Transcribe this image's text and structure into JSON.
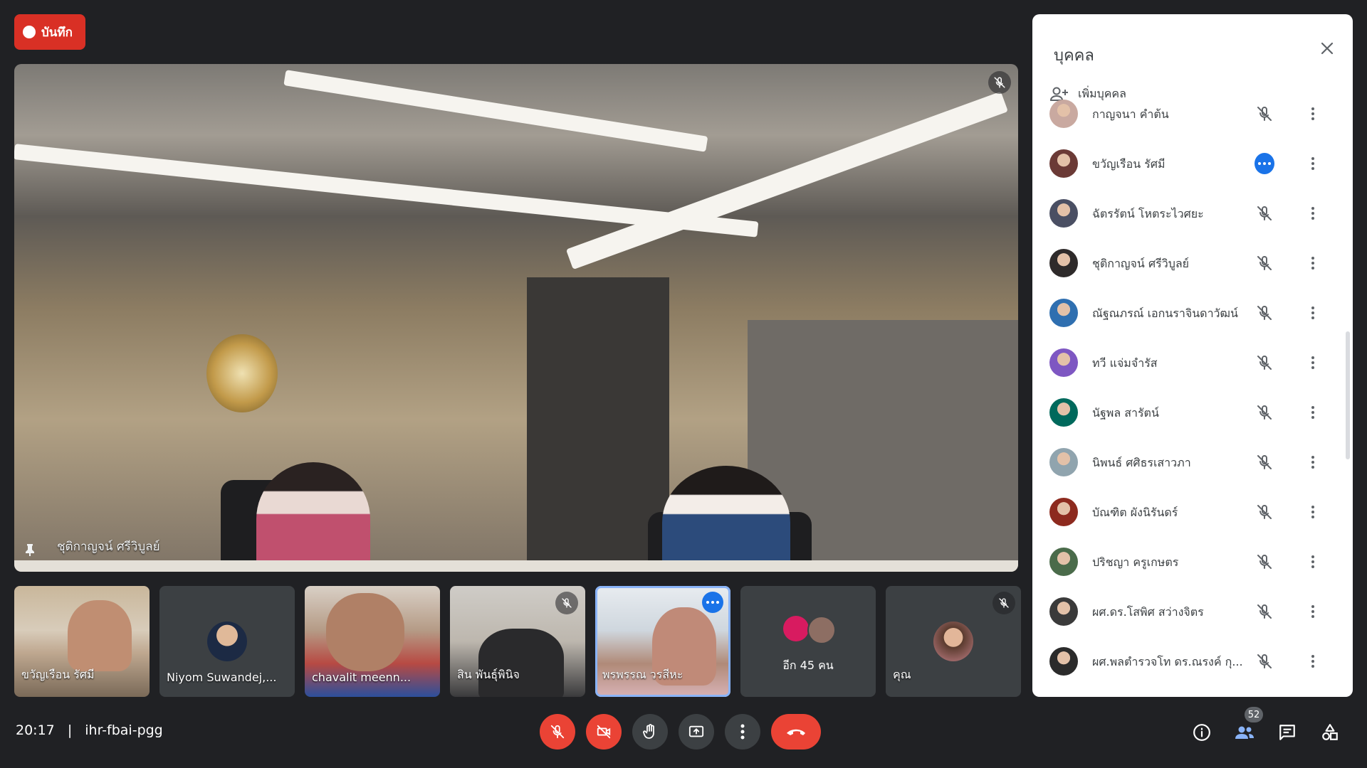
{
  "record": {
    "label": "บันทึก"
  },
  "main_video": {
    "name": "ชุติกาญจน์ ศรีวิบูลย์"
  },
  "thumbnails": [
    {
      "name": "ขวัญเรือน รัศมี"
    },
    {
      "name": "Niyom Suwandej,..."
    },
    {
      "name": "chavalit meenn..."
    },
    {
      "name": "สิน พันธุ์พินิจ"
    },
    {
      "name": "พรพรรณ วรสีหะ"
    },
    {
      "name": "อีก 45 คน"
    },
    {
      "name": "คุณ"
    }
  ],
  "meeting": {
    "time": "20:17",
    "separator": "|",
    "code": "ihr-fbai-pgg"
  },
  "controls": {
    "participants_count": "52",
    "icons": [
      "mic-off-icon",
      "camera-off-icon",
      "raise-hand-icon",
      "present-icon",
      "more-options-icon",
      "hang-up-icon",
      "info-icon",
      "people-icon",
      "chat-icon",
      "activities-icon"
    ]
  },
  "panel": {
    "title": "บุคคล",
    "add_people": "เพิ่มบุคคล",
    "people": [
      {
        "name": "กาญจนา คำต้น",
        "avatar_color": "#c9a9a0"
      },
      {
        "name": "ขวัญเรือน รัศมี",
        "avatar_color": "#6b3a36",
        "speaking": true
      },
      {
        "name": "ฉัตรรัตน์ โหตระไวศยะ",
        "avatar_color": "#4a4f63"
      },
      {
        "name": "ชุติกาญจน์ ศรีวิบูลย์",
        "avatar_color": "#2e2a2a"
      },
      {
        "name": "ณัฐณภรณ์ เอกนราจินดาวัฒน์",
        "avatar_color": "#2f6fb0"
      },
      {
        "name": "ทวี แจ่มจำรัส",
        "avatar_color": "#7e57c2"
      },
      {
        "name": "นัฐพล สารัตน์",
        "avatar_color": "#00695c"
      },
      {
        "name": "นิพนธ์ ศศิธรเสาวภา",
        "avatar_color": "#90a4ae"
      },
      {
        "name": "บัณฑิต ผังนิรันดร์",
        "avatar_color": "#8d2a1e"
      },
      {
        "name": "ปริชญา ครูเกษตร",
        "avatar_color": "#4a6b4a"
      },
      {
        "name": "ผศ.ดร.โสพิศ สว่างจิตร",
        "avatar_color": "#3a3a3a"
      },
      {
        "name": "ผศ.พลตำรวจโท ดร.ณรงค์ กุ...",
        "avatar_color": "#2b2b2b"
      }
    ]
  }
}
